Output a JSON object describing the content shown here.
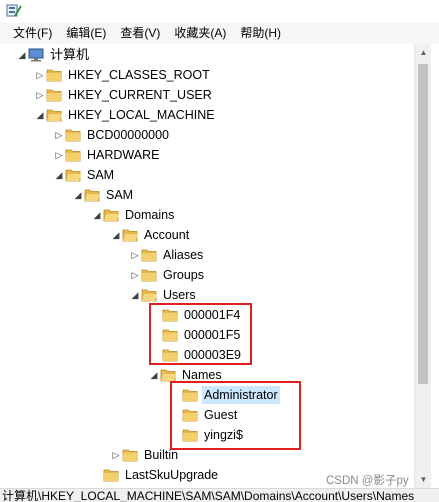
{
  "menu": {
    "items": [
      {
        "label": "文件(F)",
        "name": "menu-file"
      },
      {
        "label": "编辑(E)",
        "name": "menu-edit"
      },
      {
        "label": "查看(V)",
        "name": "menu-view"
      },
      {
        "label": "收藏夹(A)",
        "name": "menu-favorites"
      },
      {
        "label": "帮助(H)",
        "name": "menu-help"
      }
    ]
  },
  "tree": {
    "computer": "计算机",
    "hkcr": "HKEY_CLASSES_ROOT",
    "hkcu": "HKEY_CURRENT_USER",
    "hklm": "HKEY_LOCAL_MACHINE",
    "bcd": "BCD00000000",
    "hardware": "HARDWARE",
    "sam_hive": "SAM",
    "sam": "SAM",
    "domains": "Domains",
    "account": "Account",
    "aliases": "Aliases",
    "groups": "Groups",
    "users": "Users",
    "user1": "000001F4",
    "user2": "000001F5",
    "user3": "000003E9",
    "names": "Names",
    "name1": "Administrator",
    "name2": "Guest",
    "name3": "yingzi$",
    "builtin": "Builtin",
    "lastsku": "LastSkuUpgrade"
  },
  "status": {
    "path": "计算机\\HKEY_LOCAL_MACHINE\\SAM\\SAM\\Domains\\Account\\Users\\Names"
  },
  "watermark": "CSDN @影子py",
  "colors": {
    "folder": "#e8b84a",
    "highlight_box": "#e02020",
    "selected": "#cce8ff"
  }
}
